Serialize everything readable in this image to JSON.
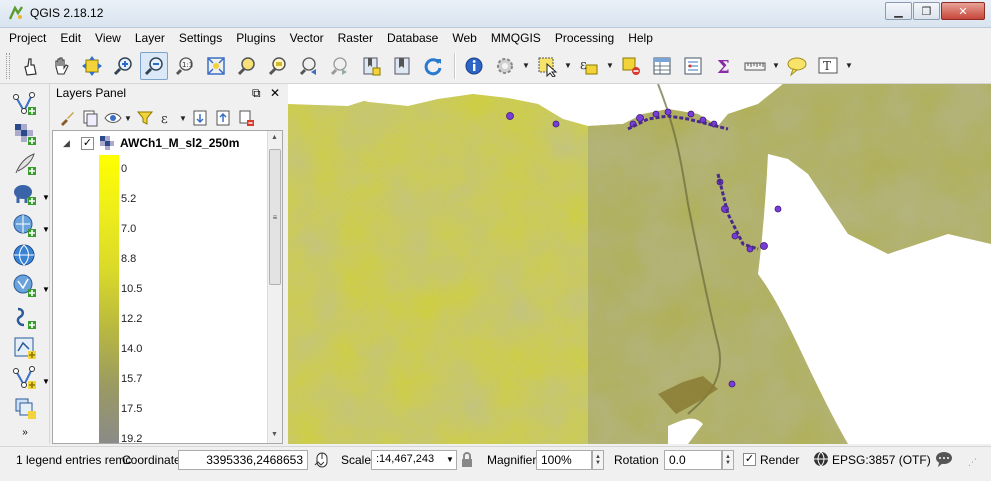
{
  "window": {
    "title": "QGIS 2.18.12",
    "minimize": "▁",
    "restore": "❐",
    "close": "✕"
  },
  "menubar": {
    "items": [
      "Project",
      "Edit",
      "View",
      "Layer",
      "Settings",
      "Plugins",
      "Vector",
      "Raster",
      "Database",
      "Web",
      "MMQGIS",
      "Processing",
      "Help"
    ]
  },
  "toolbar": {
    "icons": [
      "touch-icon",
      "pan-icon",
      "pan-to-selection-icon",
      "zoom-in-icon",
      "zoom-out-icon",
      "zoom-native-icon",
      "zoom-full-icon",
      "zoom-to-selection-icon",
      "zoom-to-layer-icon",
      "zoom-last-icon",
      "zoom-next-icon",
      "new-bookmark-icon",
      "show-bookmarks-icon",
      "refresh-icon",
      "identify-icon",
      "run-action-icon",
      "select-features-icon",
      "select-by-expression-icon",
      "deselect-icon",
      "attribute-table-icon",
      "field-calculator-icon",
      "statistics-icon",
      "measure-icon",
      "map-tips-icon",
      "text-annotation-icon"
    ]
  },
  "layers_panel": {
    "title": "Layers Panel",
    "float_label": "⧉",
    "close_label": "✕",
    "layer": {
      "name": "AWCh1_M_sl2_250m",
      "checked": "✓",
      "expander": "◢"
    },
    "legend": [
      "0",
      "5.2",
      "7.0",
      "8.8",
      "10.5",
      "12.2",
      "14.0",
      "15.7",
      "17.5",
      "19.2"
    ],
    "scroll_grip": "≡",
    "scroll_up": "▲",
    "scroll_down": "▼"
  },
  "statusbar": {
    "message": "1 legend entries remc",
    "coordinate_label": "Coordinate",
    "coordinate_value": "3395336,2468653",
    "scale_label": "Scale",
    "scale_value": ":14,467,243",
    "magnifier_label": "Magnifier",
    "magnifier_value": "100%",
    "rotation_label": "Rotation",
    "rotation_value": "0.0",
    "render_label": "Render",
    "render_checked": "✓",
    "crs_label": "EPSG:3857 (OTF)"
  },
  "colors": {
    "raster_low": "#e3e31a",
    "raster_high": "#8a8a5c",
    "coast_points": "#7a3cd8"
  }
}
